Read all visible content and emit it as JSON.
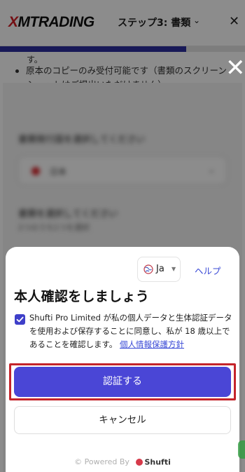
{
  "header": {
    "logo_mark": "X",
    "logo_text": "MTRADING",
    "step_title": "ステップ3: 書類",
    "step_chevron": "⌄",
    "close_glyph": "✕"
  },
  "progress": {
    "fraction": 0.76
  },
  "background_content": {
    "fragment": "す。",
    "bullet_line1": "原本のコピーのみ受付可能です（書類のスクリーン",
    "bullet_line2": "ショットはご提出いただけません）",
    "blurred_label1": "書類発行国を選択してください",
    "blurred_country": "日本",
    "blurred_label2": "書類を選択してください",
    "blurred_sub": "2つのうち1つを選択"
  },
  "overlay": {
    "close_glyph": "✕"
  },
  "modal": {
    "language": "Ja",
    "help": "ヘルプ",
    "title": "本人確認をしましょう",
    "consent_text": "Shufti Pro Limited が私の個人データと生体認証データを使用および保存することに同意し、私が 18 歳以上であることを確認します。",
    "privacy_link": "個人情報保護方針",
    "verify_button": "認証する",
    "cancel_button": "キャンセル",
    "powered_by": "© Powered By",
    "brand": "Shufti"
  },
  "colors": {
    "brand_red": "#d41e26",
    "accent_blue": "#4a46d6",
    "link_blue": "#3949d6",
    "highlight_red": "#c4242b"
  }
}
